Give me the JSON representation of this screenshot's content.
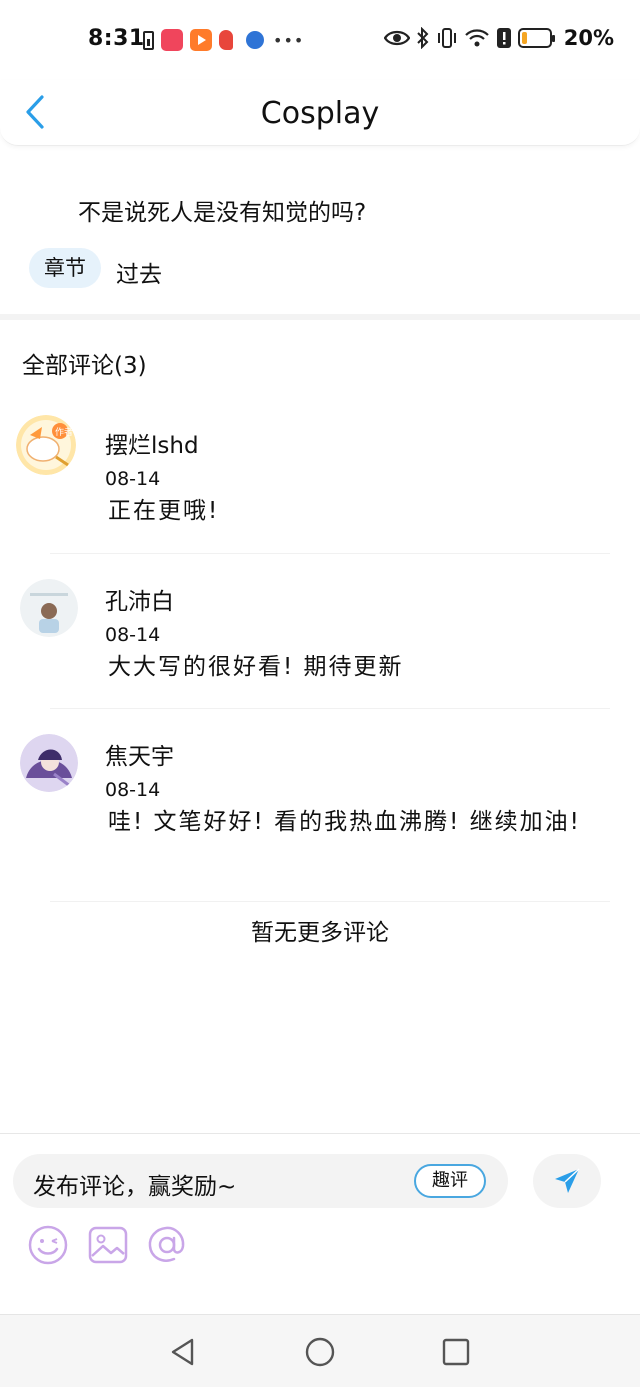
{
  "status_bar": {
    "time": "8:31",
    "battery_text": "20%",
    "battery_level": 0.2
  },
  "header": {
    "title": "Cosplay",
    "back_icon": "chevron-left-icon",
    "accent": "#2a9ee8"
  },
  "post": {
    "quote": "不是说死人是没有知觉的吗?",
    "tag_label": "章节",
    "chapter": "过去"
  },
  "comments_section": {
    "heading": "全部评论(3)",
    "comments": [
      {
        "name": "摆烂lshd",
        "date": "08-14",
        "text": "正在更哦!"
      },
      {
        "name": "孔沛白",
        "date": "08-14",
        "text": "大大写的很好看! 期待更新"
      },
      {
        "name": "焦天宇",
        "date": "08-14",
        "text": "哇! 文笔好好! 看的我热血沸腾! 继续加油!"
      }
    ],
    "no_more": "暂无更多评论"
  },
  "composer": {
    "placeholder": "发布评论，赢奖励~",
    "quping_label": "趣评",
    "send_icon": "send-icon",
    "tools": [
      "emoji-icon",
      "image-icon",
      "at-icon"
    ],
    "tool_color": "#c9a6e8"
  },
  "nav_bar": {
    "buttons": [
      "back-triangle-icon",
      "home-circle-icon",
      "recents-square-icon"
    ]
  }
}
